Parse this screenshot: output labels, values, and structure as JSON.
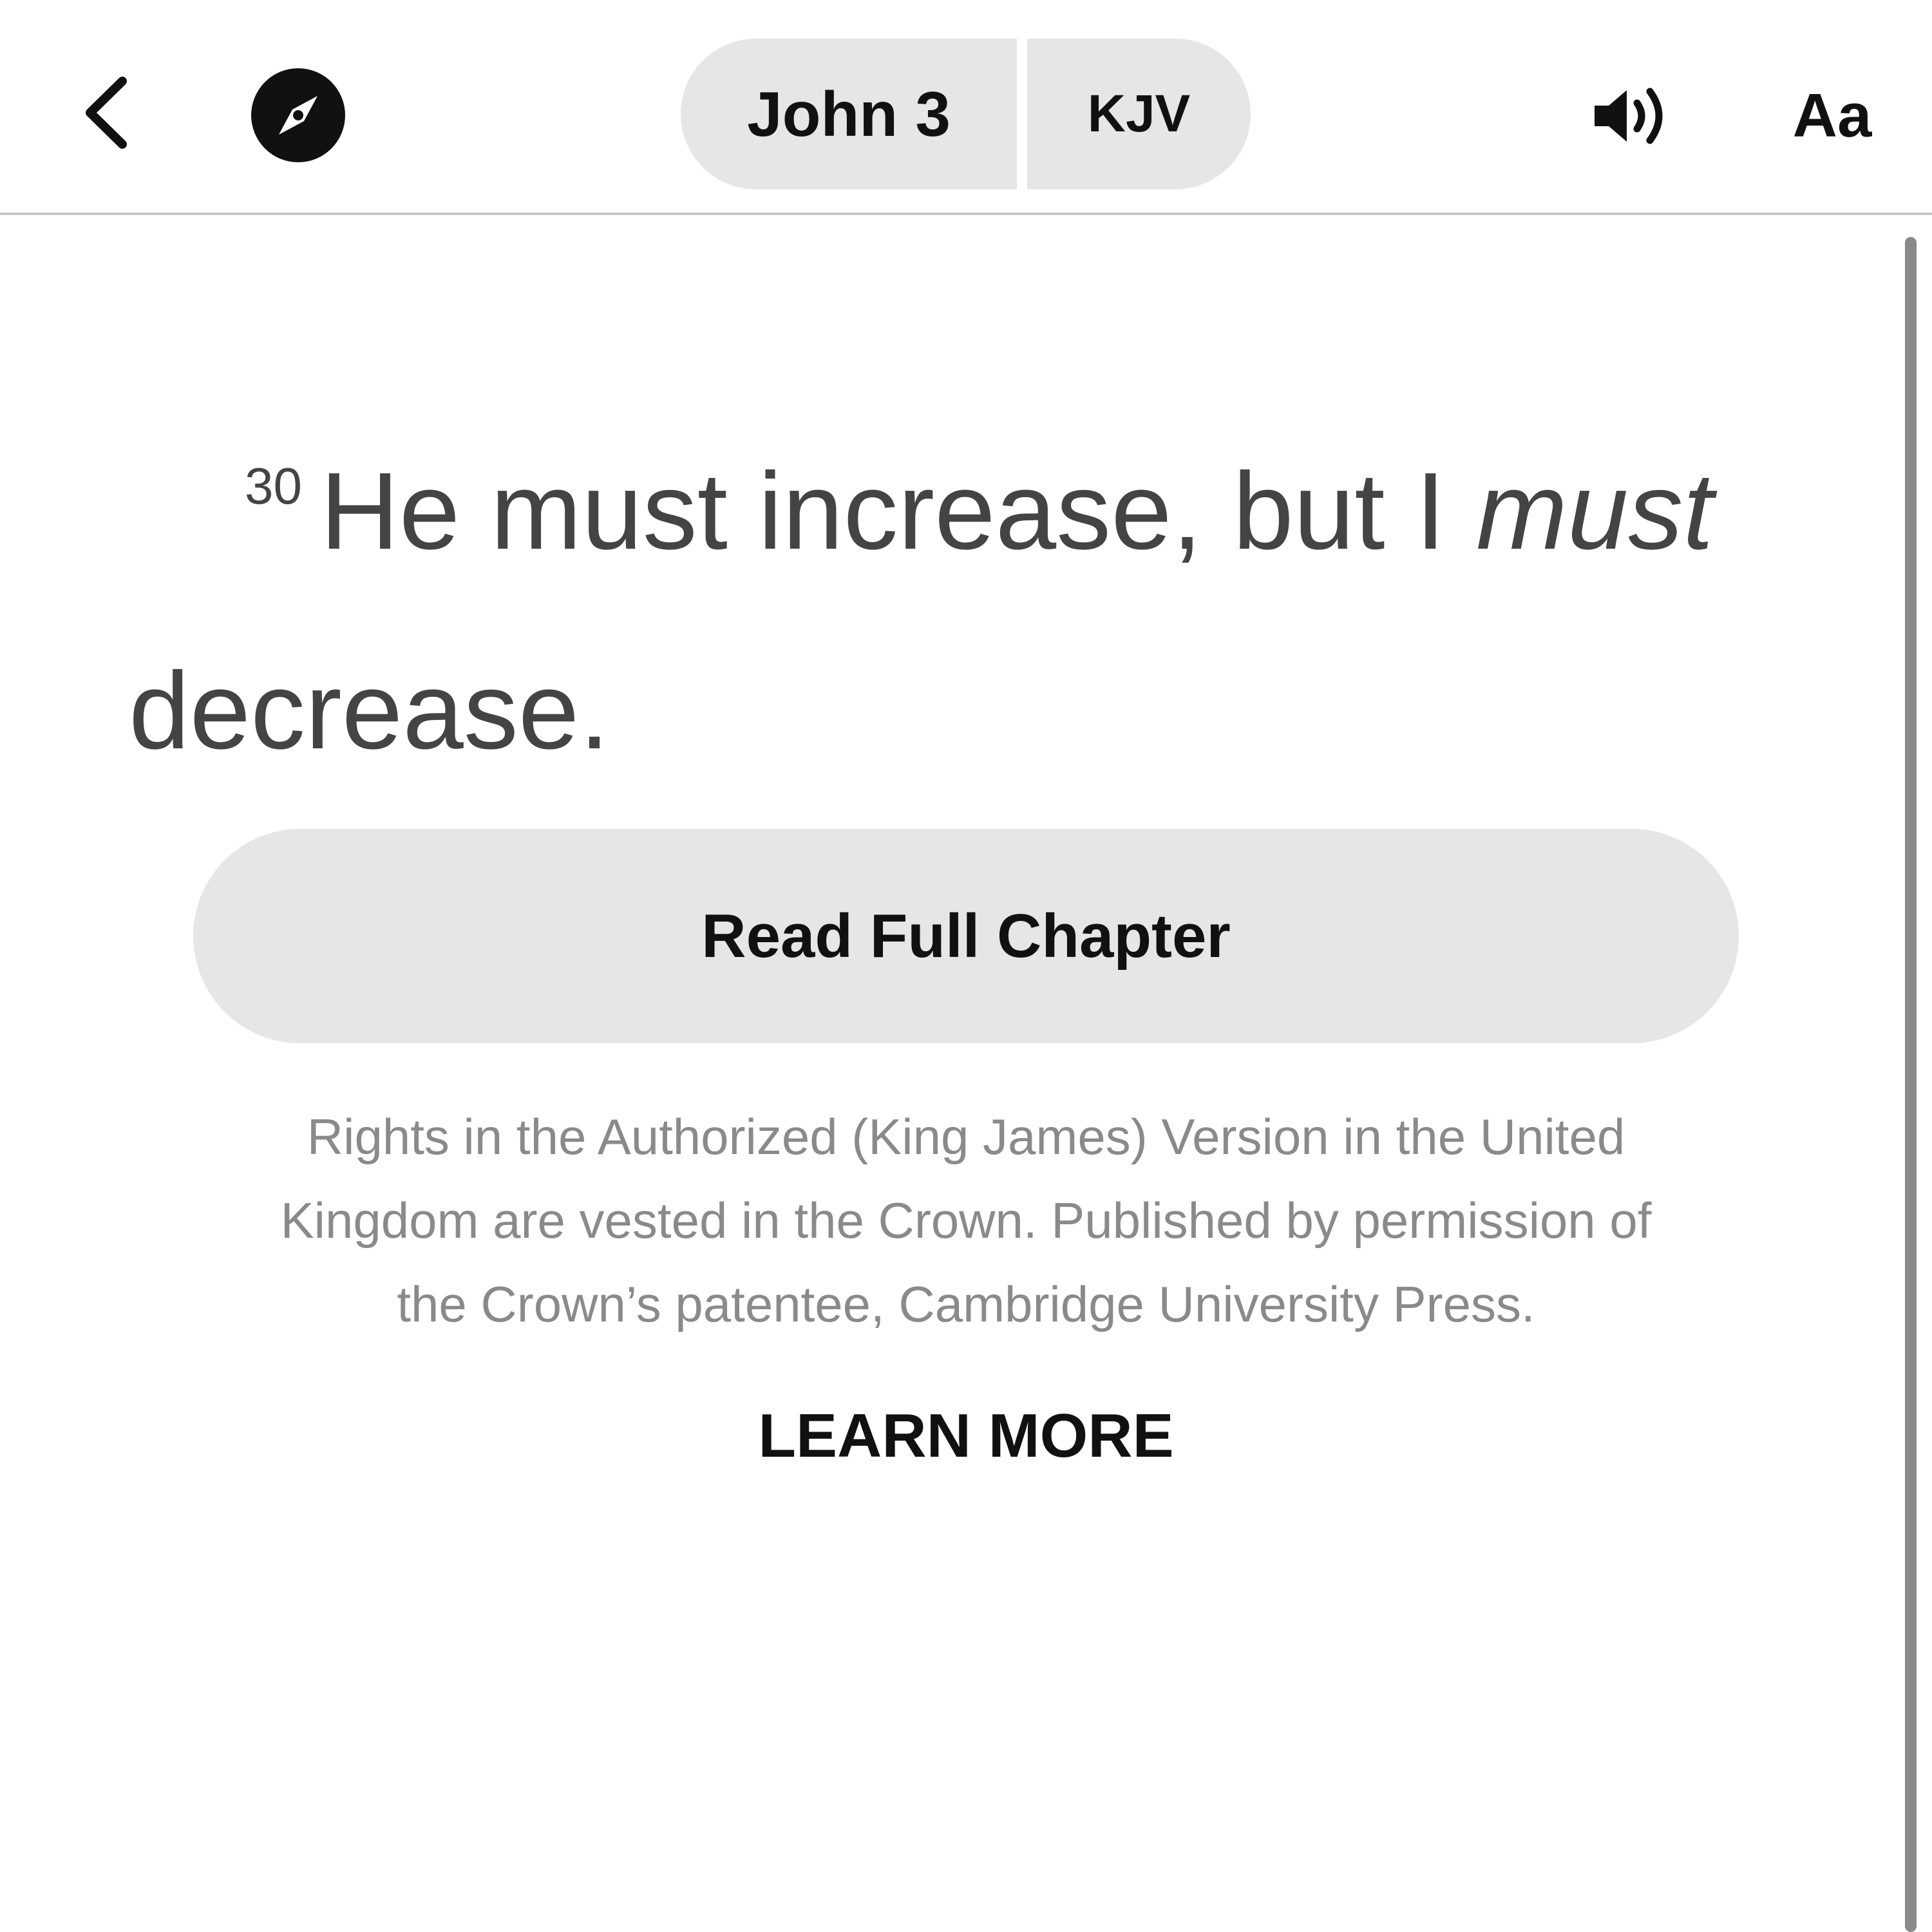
{
  "header": {
    "reference": "John 3",
    "version": "KJV",
    "font_settings_label": "Aa",
    "icons": {
      "back": "chevron-left-icon",
      "explore": "compass-icon",
      "audio": "speaker-volume-icon"
    }
  },
  "verse": {
    "number": "30",
    "text_before_italic": "He must increase, but I ",
    "italic_word": "must",
    "text_line2": "decrease."
  },
  "actions": {
    "read_full_chapter": "Read Full Chapter",
    "learn_more": "LEARN MORE"
  },
  "copyright": {
    "line1": "Rights in the Authorized (King James) Version in the United",
    "line2": "Kingdom are vested in the Crown. Published by permission of",
    "line3": "the Crown’s patentee, Cambridge University Press."
  },
  "colors": {
    "pill_background": "#e6e6e6",
    "verse_text": "#444444",
    "muted_text": "#8a8a8a",
    "primary_text": "#111111"
  }
}
